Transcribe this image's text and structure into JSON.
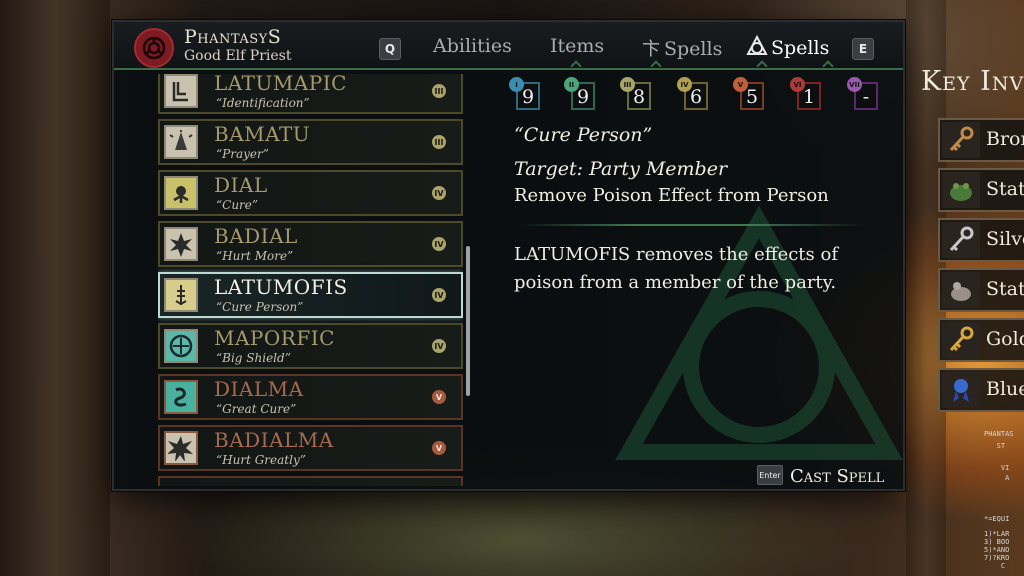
{
  "character": {
    "name": "PhantasyS",
    "class_label": "Good Elf Priest",
    "emblem_icon": "red-sigil-emblem"
  },
  "nav": {
    "prev_key": "Q",
    "next_key": "E",
    "tabs": [
      {
        "label": "Abilities",
        "icon": ""
      },
      {
        "label": "Items",
        "icon": ""
      },
      {
        "label": "Spells",
        "icon": "mage-spells-icon"
      },
      {
        "label": "Spells",
        "icon": "priest-spells-icon",
        "active": true
      }
    ]
  },
  "spell_levels": [
    {
      "roman": "I",
      "remaining": "9",
      "color": "#3a8fb0"
    },
    {
      "roman": "II",
      "remaining": "9",
      "color": "#4aa57a"
    },
    {
      "roman": "III",
      "remaining": "8",
      "color": "#a9a46a"
    },
    {
      "roman": "IV",
      "remaining": "6",
      "color": "#b0a050"
    },
    {
      "roman": "V",
      "remaining": "5",
      "color": "#c0603a"
    },
    {
      "roman": "VI",
      "remaining": "1",
      "color": "#b03a3a"
    },
    {
      "roman": "VII",
      "remaining": "-",
      "color": "#9a5ab0"
    }
  ],
  "spells": [
    {
      "name": "LATUMAPIC",
      "subtitle": "“Identification”",
      "tier": "III",
      "icon": "identification-icon"
    },
    {
      "name": "BAMATU",
      "subtitle": "“Prayer”",
      "tier": "III",
      "icon": "prayer-icon"
    },
    {
      "name": "DIAL",
      "subtitle": "“Cure”",
      "tier": "IV",
      "icon": "cure-icon"
    },
    {
      "name": "BADIAL",
      "subtitle": "“Hurt More”",
      "tier": "IV",
      "icon": "hurt-more-icon"
    },
    {
      "name": "LATUMOFIS",
      "subtitle": "“Cure Person”",
      "tier": "IV",
      "icon": "cure-person-icon",
      "selected": true
    },
    {
      "name": "MAPORFIC",
      "subtitle": "“Big Shield”",
      "tier": "IV",
      "icon": "big-shield-icon"
    },
    {
      "name": "DIALMA",
      "subtitle": "“Great Cure”",
      "tier": "V",
      "icon": "great-cure-icon"
    },
    {
      "name": "BADIALMA",
      "subtitle": "“Hurt Greatly”",
      "tier": "V",
      "icon": "hurt-greatly-icon"
    }
  ],
  "detail": {
    "quote": "“Cure Person”",
    "target": "Target: Party Member",
    "effect": "Remove Poison Effect from Person",
    "description": "LATUMOFIS removes the effects of poison from a member of the party."
  },
  "cast": {
    "key": "Enter",
    "label": "Cast Spell"
  },
  "inventory": {
    "title": "Key Inv",
    "items": [
      {
        "label": "Bron",
        "icon": "bronze-key-icon"
      },
      {
        "label": "Stat",
        "icon": "frog-statuette-icon"
      },
      {
        "label": "Silve",
        "icon": "silver-key-icon"
      },
      {
        "label": "Stat",
        "icon": "bear-statuette-icon"
      },
      {
        "label": "Gold",
        "icon": "gold-key-icon"
      },
      {
        "label": "Blue",
        "icon": "blue-ribbon-icon"
      }
    ]
  },
  "terminal_lines": [
    "PHANTAS",
    "   ST",
    "",
    "    VI",
    "     A",
    "",
    "",
    "",
    "*=EQUI",
    "",
    "1)*LAR",
    "3) BOO",
    "5)*ANO",
    "7)?KRO",
    "    C"
  ]
}
